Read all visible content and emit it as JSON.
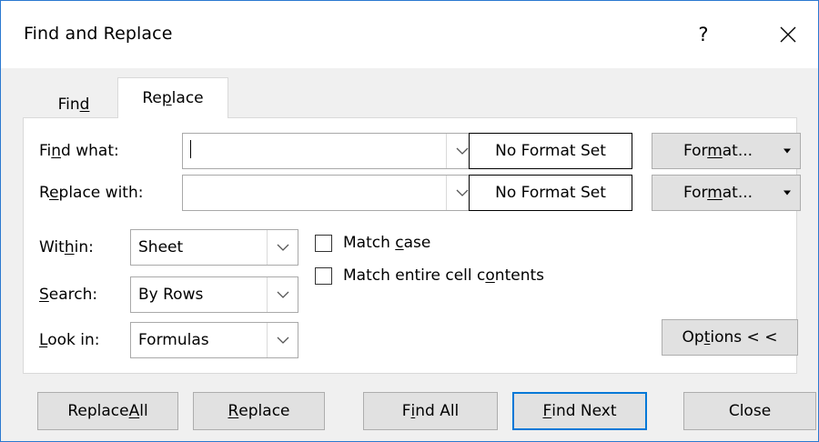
{
  "title": "Find and Replace",
  "title_buttons": {
    "help": "?"
  },
  "tabs": [
    {
      "pre": "Fin",
      "key": "d",
      "post": ""
    },
    {
      "pre": "Re",
      "key": "p",
      "post": "lace"
    }
  ],
  "find_what": {
    "label": {
      "pre": "Fi",
      "key": "n",
      "post": "d what:"
    },
    "value": "",
    "format_status": "No Format Set",
    "format_button": {
      "pre": "For",
      "key": "m",
      "post": "at..."
    }
  },
  "replace_with": {
    "label": {
      "pre": "R",
      "key": "e",
      "post": "place with:"
    },
    "value": "",
    "format_status": "No Format Set",
    "format_button": {
      "pre": "For",
      "key": "m",
      "post": "at..."
    }
  },
  "within": {
    "label": {
      "pre": "Wit",
      "key": "h",
      "post": "in:"
    },
    "value": "Sheet"
  },
  "search": {
    "label": {
      "pre": "",
      "key": "S",
      "post": "earch:"
    },
    "value": "By Rows"
  },
  "look_in": {
    "label": {
      "pre": "",
      "key": "L",
      "post": "ook in:"
    },
    "value": "Formulas"
  },
  "match_case": {
    "pre": "Match ",
    "key": "c",
    "post": "ase",
    "checked": false
  },
  "match_entire": {
    "pre": "Match entire cell c",
    "key": "o",
    "post": "ntents",
    "checked": false
  },
  "options_button": {
    "pre": "Op",
    "key": "t",
    "post": "ions < <"
  },
  "buttons": {
    "replace_all": {
      "pre": "Replace ",
      "key": "A",
      "post": "ll"
    },
    "replace": {
      "pre": "",
      "key": "R",
      "post": "eplace"
    },
    "find_all": {
      "pre": "F",
      "key": "i",
      "post": "nd All"
    },
    "find_next": {
      "pre": "",
      "key": "F",
      "post": "ind Next"
    },
    "close": {
      "pre": "Close",
      "key": "",
      "post": ""
    }
  }
}
